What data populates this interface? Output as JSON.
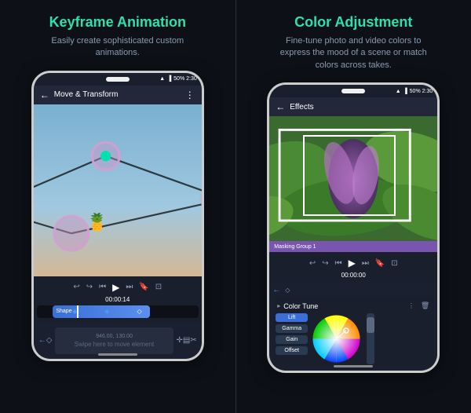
{
  "left_panel": {
    "title": "Keyframe Animation",
    "subtitle": "Easily create sophisticated custom animations.",
    "phone": {
      "status": "50%  2:30",
      "top_bar_title": "Move & Transform",
      "timecode": "00:00:14",
      "clip_label": "Shape",
      "swipe_text": "Swipe here to move element",
      "coord_text": "946.00, 130.00"
    }
  },
  "right_panel": {
    "title": "Color Adjustment",
    "subtitle": "Fine-tune photo and video colors to express the mood of a scene or match colors across takes.",
    "phone": {
      "status": "50%  2:30",
      "top_bar_title": "Effects",
      "timecode": "00:00:00",
      "masking_label": "Masking Group 1",
      "color_tune_title": "Color Tune",
      "color_params": [
        "Lift",
        "Gamma",
        "Gain",
        "Offset"
      ]
    }
  },
  "icons": {
    "back": "←",
    "menu": "⋮",
    "undo": "↩",
    "redo": "↪",
    "skip_start": "⏮",
    "play": "▶",
    "skip_end": "⏭",
    "bookmark": "🔖",
    "crop": "⊡",
    "arrow_left": "←",
    "move": "✛",
    "layers": "▤",
    "scissors": "✂",
    "diamond_blue": "◆",
    "diamond_white": "◇",
    "trash": "🗑",
    "expand": "▸"
  }
}
